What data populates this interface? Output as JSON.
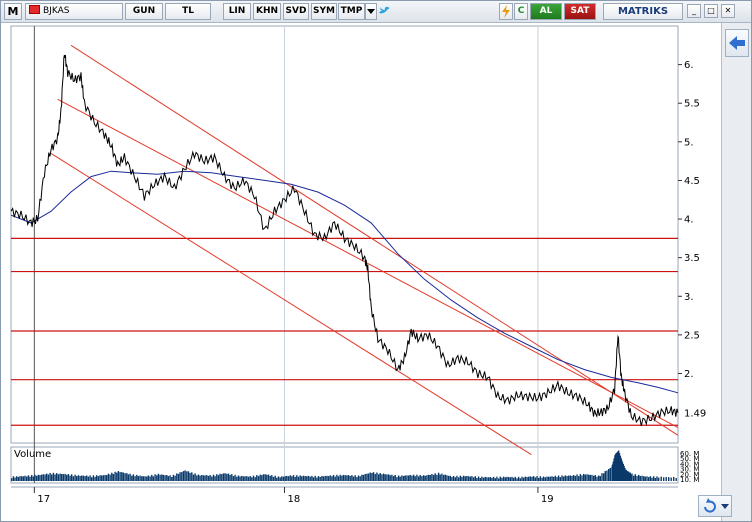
{
  "toolbar": {
    "m_label": "M",
    "symbol": "BJKAS",
    "buttons": [
      "GUN",
      "TL",
      "LIN",
      "KHN",
      "SVD",
      "SYM",
      "TMP"
    ],
    "c_label": "C",
    "al_label": "AL",
    "sat_label": "SAT",
    "brand": "MATRIKS",
    "min_label": "_",
    "max_label": "□",
    "close_label": "✕"
  },
  "colors": {
    "price": "#000000",
    "moving_average": "#1a2a9a",
    "channel": "#e23a2a",
    "support": "#cc1111",
    "volume": "#0a3a6a",
    "grid": "#c8d0da"
  },
  "icons": [
    "flag-icon",
    "dropdown-icon",
    "bird-icon",
    "lightning-icon",
    "refresh-icon",
    "back-arrow-icon",
    "window-minimize-icon",
    "window-maximize-icon",
    "window-close-icon"
  ],
  "chart_data": {
    "type": "line",
    "title": "",
    "volume_label": "Volume",
    "x_ticks": [
      "17",
      "18",
      "19"
    ],
    "y_ticks": [
      6,
      5.5,
      5,
      4.5,
      4,
      3.5,
      3,
      2.5,
      2
    ],
    "last_value_label": "1.49",
    "volume_ticks": [
      "60. M",
      "50. M",
      "40. M",
      "30. M",
      "20. M",
      "10. M"
    ],
    "ylim": [
      1.1,
      6.5
    ],
    "xlim": [
      0,
      1
    ],
    "support_levels": [
      3.75,
      3.32,
      2.55,
      1.92,
      1.33
    ],
    "channel_lines": [
      {
        "from": [
          0.09,
          6.25
        ],
        "to": [
          1.0,
          1.2
        ]
      },
      {
        "from": [
          0.07,
          5.55
        ],
        "to": [
          1.0,
          1.3
        ]
      },
      {
        "from": [
          0.06,
          4.85
        ],
        "to": [
          0.78,
          0.95
        ]
      }
    ],
    "moving_average": [
      [
        0.0,
        4.05
      ],
      [
        0.03,
        3.95
      ],
      [
        0.06,
        4.1
      ],
      [
        0.09,
        4.35
      ],
      [
        0.12,
        4.55
      ],
      [
        0.15,
        4.62
      ],
      [
        0.18,
        4.6
      ],
      [
        0.22,
        4.58
      ],
      [
        0.26,
        4.62
      ],
      [
        0.3,
        4.6
      ],
      [
        0.34,
        4.55
      ],
      [
        0.38,
        4.5
      ],
      [
        0.42,
        4.45
      ],
      [
        0.46,
        4.35
      ],
      [
        0.5,
        4.18
      ],
      [
        0.54,
        3.95
      ],
      [
        0.58,
        3.55
      ],
      [
        0.62,
        3.22
      ],
      [
        0.66,
        2.95
      ],
      [
        0.7,
        2.72
      ],
      [
        0.74,
        2.52
      ],
      [
        0.78,
        2.35
      ],
      [
        0.82,
        2.18
      ],
      [
        0.86,
        2.05
      ],
      [
        0.9,
        1.95
      ],
      [
        0.94,
        1.88
      ],
      [
        0.97,
        1.82
      ],
      [
        1.0,
        1.75
      ]
    ],
    "price": [
      [
        0.0,
        4.1
      ],
      [
        0.015,
        4.05
      ],
      [
        0.03,
        3.95
      ],
      [
        0.04,
        4.0
      ],
      [
        0.05,
        4.6
      ],
      [
        0.06,
        4.9
      ],
      [
        0.07,
        5.05
      ],
      [
        0.075,
        5.4
      ],
      [
        0.08,
        6.15
      ],
      [
        0.085,
        5.9
      ],
      [
        0.095,
        5.8
      ],
      [
        0.105,
        5.85
      ],
      [
        0.11,
        5.5
      ],
      [
        0.125,
        5.25
      ],
      [
        0.14,
        5.1
      ],
      [
        0.15,
        4.95
      ],
      [
        0.16,
        4.7
      ],
      [
        0.17,
        4.8
      ],
      [
        0.185,
        4.55
      ],
      [
        0.2,
        4.3
      ],
      [
        0.215,
        4.45
      ],
      [
        0.23,
        4.55
      ],
      [
        0.245,
        4.4
      ],
      [
        0.26,
        4.65
      ],
      [
        0.275,
        4.85
      ],
      [
        0.29,
        4.75
      ],
      [
        0.305,
        4.8
      ],
      [
        0.32,
        4.55
      ],
      [
        0.335,
        4.4
      ],
      [
        0.35,
        4.5
      ],
      [
        0.365,
        4.3
      ],
      [
        0.38,
        3.85
      ],
      [
        0.395,
        4.1
      ],
      [
        0.41,
        4.25
      ],
      [
        0.425,
        4.4
      ],
      [
        0.44,
        4.1
      ],
      [
        0.455,
        3.8
      ],
      [
        0.47,
        3.75
      ],
      [
        0.485,
        3.95
      ],
      [
        0.5,
        3.75
      ],
      [
        0.515,
        3.65
      ],
      [
        0.53,
        3.5
      ],
      [
        0.535,
        3.35
      ],
      [
        0.54,
        2.85
      ],
      [
        0.55,
        2.45
      ],
      [
        0.565,
        2.3
      ],
      [
        0.58,
        2.05
      ],
      [
        0.59,
        2.2
      ],
      [
        0.6,
        2.55
      ],
      [
        0.61,
        2.45
      ],
      [
        0.625,
        2.5
      ],
      [
        0.64,
        2.35
      ],
      [
        0.655,
        2.1
      ],
      [
        0.67,
        2.2
      ],
      [
        0.685,
        2.15
      ],
      [
        0.7,
        2.0
      ],
      [
        0.715,
        1.95
      ],
      [
        0.73,
        1.7
      ],
      [
        0.745,
        1.65
      ],
      [
        0.76,
        1.72
      ],
      [
        0.775,
        1.7
      ],
      [
        0.79,
        1.68
      ],
      [
        0.805,
        1.75
      ],
      [
        0.82,
        1.85
      ],
      [
        0.835,
        1.75
      ],
      [
        0.85,
        1.7
      ],
      [
        0.865,
        1.6
      ],
      [
        0.875,
        1.48
      ],
      [
        0.885,
        1.5
      ],
      [
        0.895,
        1.55
      ],
      [
        0.905,
        1.8
      ],
      [
        0.91,
        2.5
      ],
      [
        0.915,
        1.95
      ],
      [
        0.92,
        1.75
      ],
      [
        0.93,
        1.45
      ],
      [
        0.945,
        1.38
      ],
      [
        0.96,
        1.42
      ],
      [
        0.975,
        1.5
      ],
      [
        0.99,
        1.52
      ],
      [
        1.0,
        1.49
      ]
    ],
    "volume": [
      [
        0.0,
        6
      ],
      [
        0.02,
        8
      ],
      [
        0.04,
        10
      ],
      [
        0.06,
        14
      ],
      [
        0.08,
        12
      ],
      [
        0.1,
        9
      ],
      [
        0.12,
        8
      ],
      [
        0.14,
        10
      ],
      [
        0.16,
        18
      ],
      [
        0.18,
        11
      ],
      [
        0.2,
        7
      ],
      [
        0.22,
        12
      ],
      [
        0.24,
        8
      ],
      [
        0.26,
        20
      ],
      [
        0.28,
        10
      ],
      [
        0.3,
        9
      ],
      [
        0.32,
        14
      ],
      [
        0.34,
        8
      ],
      [
        0.36,
        7
      ],
      [
        0.38,
        12
      ],
      [
        0.4,
        6
      ],
      [
        0.42,
        9
      ],
      [
        0.44,
        8
      ],
      [
        0.46,
        7
      ],
      [
        0.48,
        9
      ],
      [
        0.5,
        10
      ],
      [
        0.52,
        8
      ],
      [
        0.54,
        16
      ],
      [
        0.56,
        12
      ],
      [
        0.58,
        8
      ],
      [
        0.6,
        10
      ],
      [
        0.62,
        9
      ],
      [
        0.64,
        14
      ],
      [
        0.66,
        7
      ],
      [
        0.68,
        8
      ],
      [
        0.7,
        6
      ],
      [
        0.72,
        5
      ],
      [
        0.74,
        6
      ],
      [
        0.76,
        5
      ],
      [
        0.78,
        7
      ],
      [
        0.8,
        6
      ],
      [
        0.82,
        8
      ],
      [
        0.84,
        9
      ],
      [
        0.86,
        12
      ],
      [
        0.88,
        8
      ],
      [
        0.9,
        28
      ],
      [
        0.905,
        55
      ],
      [
        0.91,
        62
      ],
      [
        0.915,
        40
      ],
      [
        0.92,
        22
      ],
      [
        0.93,
        12
      ],
      [
        0.95,
        7
      ],
      [
        0.97,
        6
      ],
      [
        1.0,
        5
      ]
    ]
  }
}
